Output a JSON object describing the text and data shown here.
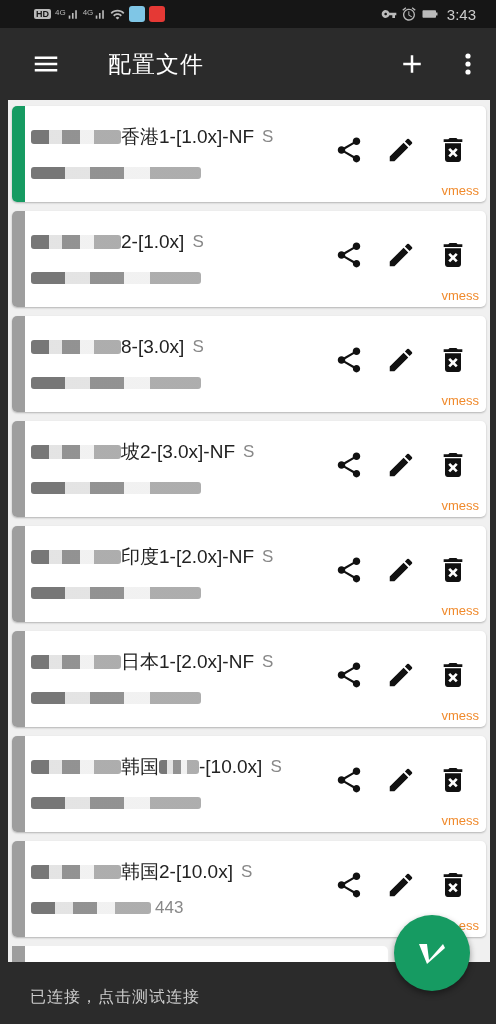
{
  "status_bar": {
    "hd": "HD",
    "network_labels": [
      "4G",
      "4G"
    ],
    "time": "3:43"
  },
  "app_bar": {
    "title": "配置文件"
  },
  "profiles": [
    {
      "selected": true,
      "name_parts": [
        {
          "kind": "redacted"
        },
        {
          "kind": "text",
          "text": "香港1-[1.0x]-NF"
        }
      ],
      "status": "S",
      "address_parts": [
        {
          "kind": "redacted"
        }
      ],
      "protocol": "vmess"
    },
    {
      "selected": false,
      "name_parts": [
        {
          "kind": "redacted"
        },
        {
          "kind": "text",
          "text": "2-[1.0x]"
        }
      ],
      "status": "S",
      "address_parts": [
        {
          "kind": "redacted"
        }
      ],
      "protocol": "vmess"
    },
    {
      "selected": false,
      "name_parts": [
        {
          "kind": "redacted"
        },
        {
          "kind": "text",
          "text": "8-[3.0x]"
        }
      ],
      "status": "S",
      "address_parts": [
        {
          "kind": "redacted"
        }
      ],
      "protocol": "vmess"
    },
    {
      "selected": false,
      "name_parts": [
        {
          "kind": "redacted"
        },
        {
          "kind": "text",
          "text": "坡2-[3.0x]-NF"
        }
      ],
      "status": "S",
      "address_parts": [
        {
          "kind": "redacted"
        }
      ],
      "protocol": "vmess"
    },
    {
      "selected": false,
      "name_parts": [
        {
          "kind": "redacted"
        },
        {
          "kind": "text",
          "text": "印度1-[2.0x]-NF"
        }
      ],
      "status": "S",
      "address_parts": [
        {
          "kind": "redacted"
        }
      ],
      "protocol": "vmess"
    },
    {
      "selected": false,
      "name_parts": [
        {
          "kind": "redacted"
        },
        {
          "kind": "text",
          "text": "日本1-[2.0x]-NF"
        }
      ],
      "status": "S",
      "address_parts": [
        {
          "kind": "redacted"
        }
      ],
      "protocol": "vmess"
    },
    {
      "selected": false,
      "name_parts": [
        {
          "kind": "redacted"
        },
        {
          "kind": "text",
          "text": "韩国"
        },
        {
          "kind": "redacted"
        },
        {
          "kind": "text",
          "text": "-[10.0x]"
        }
      ],
      "status": "S",
      "address_parts": [
        {
          "kind": "redacted"
        }
      ],
      "protocol": "vmess"
    },
    {
      "selected": false,
      "name_parts": [
        {
          "kind": "redacted"
        },
        {
          "kind": "text",
          "text": "韩国2-[10.0x]"
        }
      ],
      "status": "S",
      "address_parts": [
        {
          "kind": "redacted"
        },
        {
          "kind": "text",
          "text": "443"
        }
      ],
      "protocol": "ess"
    }
  ],
  "snackbar": {
    "message": "已连接，点击测试连接"
  }
}
